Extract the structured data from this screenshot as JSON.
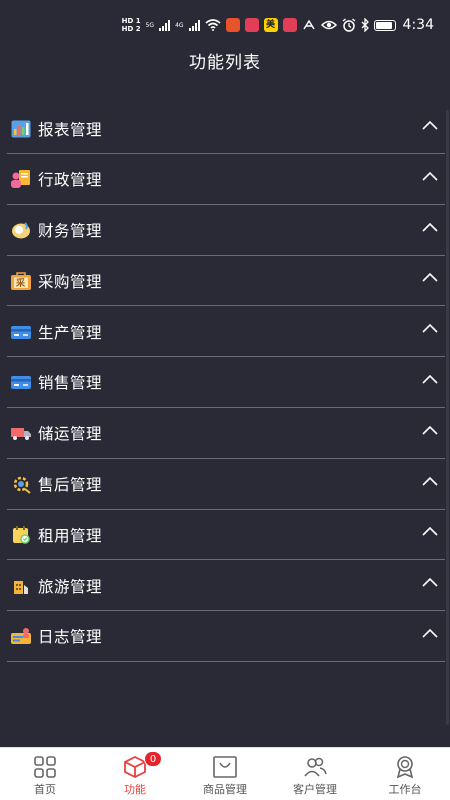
{
  "status_bar": {
    "hd1": "HD 1",
    "hd2": "HD 2",
    "net1": "5G",
    "net2": "4G",
    "badge_mei": "美",
    "time": "4:34",
    "icons": [
      "signal-icon",
      "wifi-icon",
      "app-icon",
      "eye-icon",
      "alarm-icon",
      "bluetooth-icon",
      "battery-icon"
    ]
  },
  "header": {
    "title": "功能列表"
  },
  "menu": {
    "items": [
      {
        "label": "报表管理",
        "icon": "report-icon"
      },
      {
        "label": "行政管理",
        "icon": "admin-icon"
      },
      {
        "label": "财务管理",
        "icon": "finance-icon"
      },
      {
        "label": "采购管理",
        "icon": "purchase-icon",
        "icon_text": "采"
      },
      {
        "label": "生产管理",
        "icon": "production-icon"
      },
      {
        "label": "销售管理",
        "icon": "sales-icon"
      },
      {
        "label": "储运管理",
        "icon": "truck-icon"
      },
      {
        "label": "售后管理",
        "icon": "after-sales-icon"
      },
      {
        "label": "租用管理",
        "icon": "rental-icon"
      },
      {
        "label": "旅游管理",
        "icon": "travel-icon"
      },
      {
        "label": "日志管理",
        "icon": "log-icon"
      }
    ]
  },
  "tabbar": {
    "tabs": [
      {
        "label": "首页",
        "icon": "home-grid-icon"
      },
      {
        "label": "功能",
        "icon": "box-icon",
        "badge": "0"
      },
      {
        "label": "商品管理",
        "icon": "bag-icon"
      },
      {
        "label": "客户管理",
        "icon": "people-icon"
      },
      {
        "label": "工作台",
        "icon": "medal-icon"
      }
    ],
    "active_index": 1
  },
  "colors": {
    "background": "#2a2a36",
    "divider": "#6b6b78",
    "active_tab": "#e4423f",
    "badge": "#e4232a"
  }
}
